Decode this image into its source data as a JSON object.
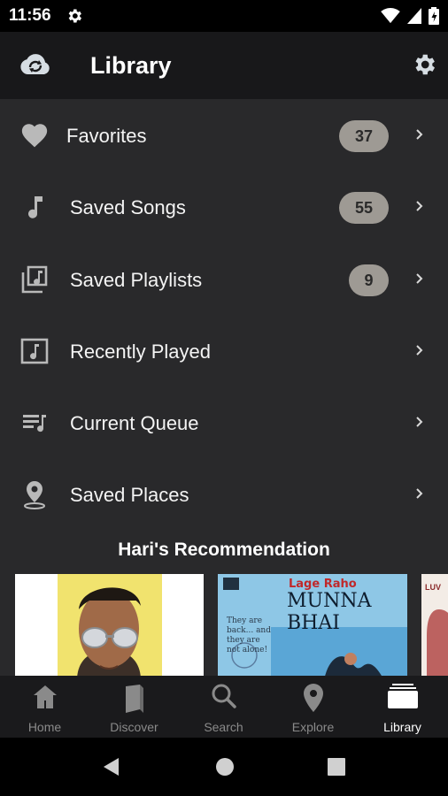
{
  "status_bar": {
    "time": "11:56"
  },
  "app_bar": {
    "title": "Library"
  },
  "menu": [
    {
      "label": "Favorites",
      "count": "37",
      "icon": "heart-icon"
    },
    {
      "label": "Saved Songs",
      "count": "55",
      "icon": "music-note-icon"
    },
    {
      "label": "Saved Playlists",
      "count": "9",
      "icon": "playlist-icon"
    },
    {
      "label": "Recently Played",
      "count": "",
      "icon": "recent-music-icon"
    },
    {
      "label": "Current Queue",
      "count": "",
      "icon": "queue-icon"
    },
    {
      "label": "Saved Places",
      "count": "",
      "icon": "location-icon"
    }
  ],
  "recommendation": {
    "title": "Hari's Recommendation",
    "cards": [
      {
        "text": ""
      },
      {
        "title_small": "Lage Raho",
        "title_big": "MUNNA BHAI",
        "tagline": "They are back... and they are not alone!"
      },
      {
        "text": "LUV"
      }
    ]
  },
  "bottom_nav": [
    {
      "label": "Home",
      "icon": "home-icon",
      "active": false
    },
    {
      "label": "Discover",
      "icon": "book-icon",
      "active": false
    },
    {
      "label": "Search",
      "icon": "search-icon",
      "active": false
    },
    {
      "label": "Explore",
      "icon": "location-icon",
      "active": false
    },
    {
      "label": "Library",
      "icon": "library-icon",
      "active": true
    }
  ],
  "colors": {
    "background": "#29292b",
    "app_bar": "#18181a",
    "badge": "#9e9a94",
    "nav_inactive": "#8a8a8a",
    "nav_active": "#ffffff"
  }
}
